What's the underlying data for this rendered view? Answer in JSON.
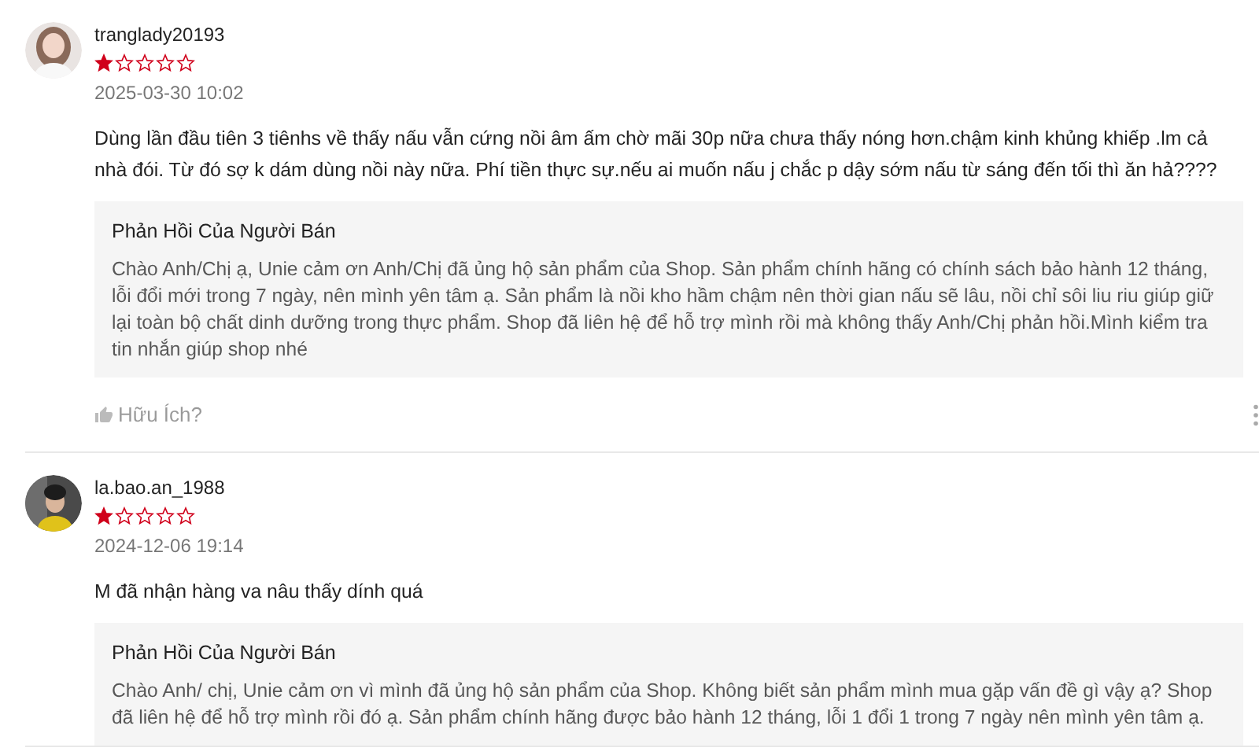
{
  "reviews": [
    {
      "username": "tranglady20193",
      "stars": 1,
      "date": "2025-03-30 10:02",
      "text": "Dùng lần đầu tiên 3 tiênhs về thấy nấu vẫn cứng nồi âm ấm chờ mãi 30p nữa chưa thấy nóng hơn.chậm kinh khủng khiếp .lm cả nhà đói. Từ đó sợ k dám dùng nồi này nữa. Phí tiền thực sự.nếu ai muốn nấu j chắc p dậy sớm nấu từ sáng đến tối thì ăn hả????",
      "reply": {
        "title": "Phản Hồi Của Người Bán",
        "text": "Chào Anh/Chị ạ, Unie cảm ơn Anh/Chị đã ủng hộ sản phẩm của Shop. Sản phẩm chính hãng có chính sách bảo hành 12 tháng, lỗi đổi mới trong 7 ngày, nên mình yên tâm ạ. Sản phẩm là nồi kho hầm chậm nên thời gian nấu sẽ lâu, nồi chỉ sôi liu riu giúp giữ lại toàn bộ chất dinh dưỡng trong thực phẩm. Shop đã liên hệ để hỗ trợ mình rồi mà không thấy Anh/Chị phản hồi.Mình kiểm tra tin nhắn giúp shop nhé"
      },
      "helpful": "Hữu Ích?"
    },
    {
      "username": "la.bao.an_1988",
      "stars": 1,
      "date": "2024-12-06 19:14",
      "text": "M đã nhận hàng va nâu thấy dính quá",
      "reply": {
        "title": "Phản Hồi Của Người Bán",
        "text": "Chào Anh/ chị, Unie cảm ơn vì mình đã ủng hộ sản phẩm của Shop. Không biết sản phẩm mình mua gặp vấn đề gì vậy ạ? Shop đã liên hệ để hỗ trợ mình rồi đó ạ. Sản phẩm chính hãng được bảo hành 12 tháng, lỗi 1 đổi 1 trong 7 ngày nên mình yên tâm ạ."
      }
    }
  ]
}
